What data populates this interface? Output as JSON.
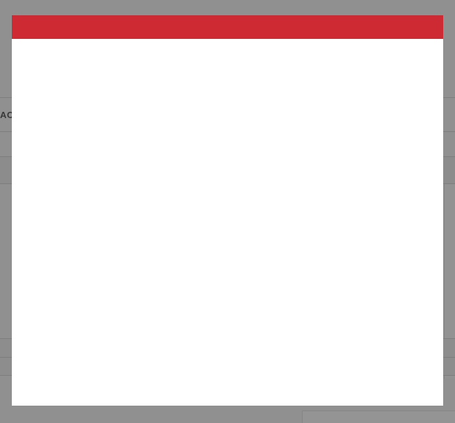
{
  "background": {
    "label_fragment": "AC"
  },
  "modal": {
    "header_color": "#ce2a34"
  }
}
